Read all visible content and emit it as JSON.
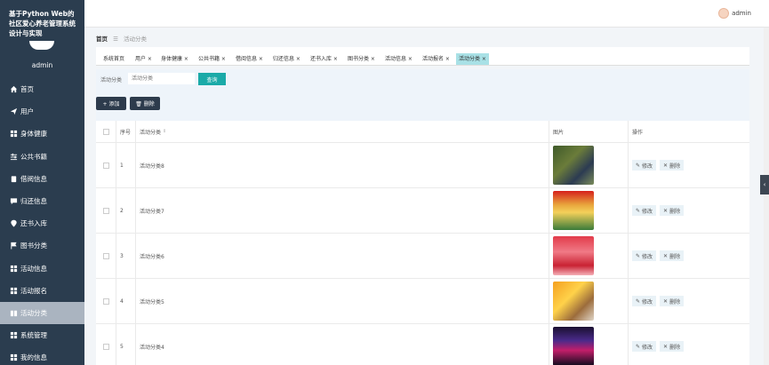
{
  "app": {
    "title": "基于Python Web的社区爱心养老管理系统设计与实现",
    "sidebar_user": "admin"
  },
  "topbar": {
    "user": "admin"
  },
  "sidebar": {
    "items": [
      {
        "label": "首页",
        "icon": "home-icon"
      },
      {
        "label": "用户",
        "icon": "send-icon"
      },
      {
        "label": "身体健康",
        "icon": "grid-icon"
      },
      {
        "label": "公共书籍",
        "icon": "sliders-icon"
      },
      {
        "label": "借阅信息",
        "icon": "clipboard-icon"
      },
      {
        "label": "归还信息",
        "icon": "chat-icon"
      },
      {
        "label": "还书入库",
        "icon": "pin-icon"
      },
      {
        "label": "图书分类",
        "icon": "flag-icon"
      },
      {
        "label": "活动信息",
        "icon": "grid-icon"
      },
      {
        "label": "活动报名",
        "icon": "grid-icon"
      },
      {
        "label": "活动分类",
        "icon": "book-icon"
      },
      {
        "label": "系统管理",
        "icon": "grid-icon"
      },
      {
        "label": "我的信息",
        "icon": "grid-icon"
      }
    ],
    "active_index": 10
  },
  "breadcrumb": {
    "home": "首页",
    "sep": "☰",
    "current": "活动分类"
  },
  "tags": [
    {
      "label": "系统首页"
    },
    {
      "label": "用户 ×"
    },
    {
      "label": "身体健康 ×"
    },
    {
      "label": "公共书籍 ×"
    },
    {
      "label": "借阅信息 ×"
    },
    {
      "label": "归还信息 ×"
    },
    {
      "label": "还书入库 ×"
    },
    {
      "label": "图书分类 ×"
    },
    {
      "label": "活动信息 ×"
    },
    {
      "label": "活动报名 ×"
    },
    {
      "label": "活动分类 ×"
    }
  ],
  "search": {
    "label": "活动分类",
    "placeholder": "活动分类",
    "query_button": "查询"
  },
  "actions": {
    "add": "添加",
    "delete": "删除"
  },
  "table": {
    "headers": {
      "no": "序号",
      "name": "活动分类",
      "image": "图片",
      "op": "操作"
    },
    "sort_icon": "⇕",
    "edit_label": "修改",
    "delete_label": "删除",
    "rows": [
      {
        "no": "1",
        "name": "活动分类8"
      },
      {
        "no": "2",
        "name": "活动分类7"
      },
      {
        "no": "3",
        "name": "活动分类6"
      },
      {
        "no": "4",
        "name": "活动分类5"
      },
      {
        "no": "5",
        "name": "活动分类4"
      }
    ]
  },
  "colors": {
    "sidebar": "#2b3d4f",
    "accent": "#1baaa8",
    "active_tag": "#a9e1e6"
  }
}
